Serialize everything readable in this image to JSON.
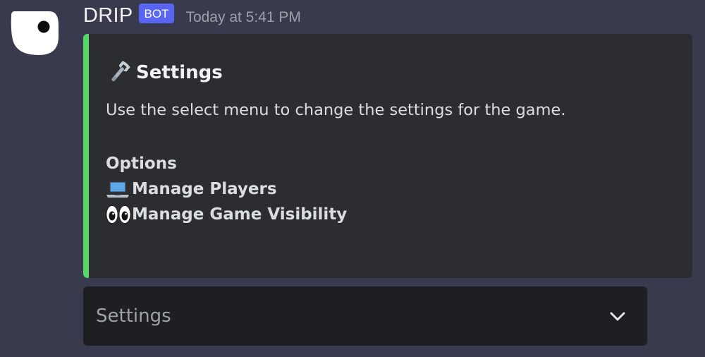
{
  "message": {
    "author": "DRIP",
    "badge": "BOT",
    "timestamp": "Today at 5:41 PM"
  },
  "embed": {
    "accent_color": "#57d66a",
    "title_icon": "wrench-icon",
    "title": "Settings",
    "description": "Use the select menu to change the settings for the game.",
    "options_heading": "Options",
    "options": [
      {
        "icon": "laptop-icon",
        "label": "Manage Players"
      },
      {
        "icon": "eyes-icon",
        "label": "Manage Game Visibility"
      }
    ]
  },
  "select_menu": {
    "placeholder": "Settings",
    "icon": "chevron-down-icon"
  },
  "colors": {
    "background": "#393a4e",
    "embed_background": "#2b2d31",
    "select_background": "#1e1f22",
    "bot_badge": "#5865f2"
  }
}
